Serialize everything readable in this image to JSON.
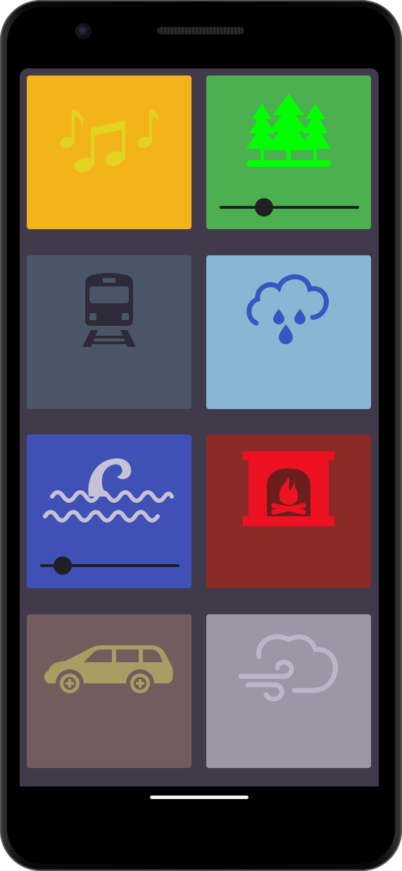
{
  "app": {
    "background": "#403a4a"
  },
  "tiles": [
    {
      "name": "music",
      "icon": "music-notes-icon",
      "bg": "#f2b31b",
      "fg": "#e3d21f",
      "has_slider": false
    },
    {
      "name": "forest",
      "icon": "pine-trees-icon",
      "bg": "#4caf50",
      "fg": "#00ff00",
      "has_slider": true,
      "slider_value": 0.32
    },
    {
      "name": "train",
      "icon": "train-icon",
      "bg": "#4a5568",
      "fg": "#2e2a38",
      "has_slider": false
    },
    {
      "name": "rain",
      "icon": "rain-cloud-icon",
      "bg": "#88b7d3",
      "fg": "#3557c2",
      "has_slider": false
    },
    {
      "name": "waves",
      "icon": "ocean-waves-icon",
      "bg": "#3f51b5",
      "fg": "#c6c2d6",
      "has_slider": true,
      "slider_value": 0.16
    },
    {
      "name": "fireplace",
      "icon": "fireplace-icon",
      "bg": "#8b2a26",
      "fg": "#ee1122",
      "has_slider": false
    },
    {
      "name": "car",
      "icon": "car-icon",
      "bg": "#735d5c",
      "fg": "#a89e64",
      "has_slider": false
    },
    {
      "name": "wind",
      "icon": "wind-cloud-icon",
      "bg": "#9d96a7",
      "fg": "#bdb6c8",
      "has_slider": false
    }
  ]
}
